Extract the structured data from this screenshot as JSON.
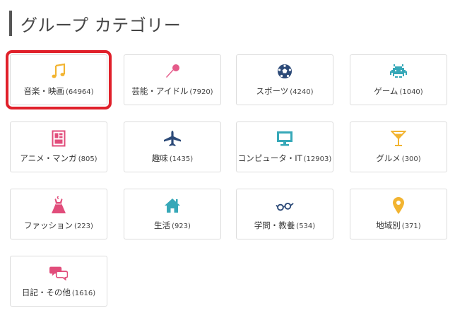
{
  "page": {
    "title": "グループ カテゴリー"
  },
  "categories": [
    {
      "label": "音楽・映画",
      "count": "(64964)",
      "icon": "music-note-icon",
      "color": "#f2b431",
      "selected": true
    },
    {
      "label": "芸能・アイドル",
      "count": "(7920)",
      "icon": "microphone-icon",
      "color": "#e55b8a"
    },
    {
      "label": "スポーツ",
      "count": "(4240)",
      "icon": "soccer-ball-icon",
      "color": "#2c4a78"
    },
    {
      "label": "ゲーム",
      "count": "(1040)",
      "icon": "space-invader-icon",
      "color": "#36a8b8"
    },
    {
      "label": "アニメ・マンガ",
      "count": "(805)",
      "icon": "manga-book-icon",
      "color": "#e14d7b"
    },
    {
      "label": "趣味",
      "count": "(1435)",
      "icon": "airplane-icon",
      "color": "#2c4a78"
    },
    {
      "label": "コンピュータ・IT",
      "count": "(12903)",
      "icon": "monitor-icon",
      "color": "#36a8b8"
    },
    {
      "label": "グルメ",
      "count": "(300)",
      "icon": "cocktail-glass-icon",
      "color": "#f2b431"
    },
    {
      "label": "ファッション",
      "count": "(223)",
      "icon": "dress-icon",
      "color": "#e14d7b"
    },
    {
      "label": "生活",
      "count": "(923)",
      "icon": "house-icon",
      "color": "#36a8b8"
    },
    {
      "label": "学問・教養",
      "count": "(534)",
      "icon": "glasses-icon",
      "color": "#2c4a78"
    },
    {
      "label": "地域別",
      "count": "(371)",
      "icon": "map-pin-icon",
      "color": "#f2b431"
    },
    {
      "label": "日記・その他",
      "count": "(1616)",
      "icon": "speech-bubbles-icon",
      "color": "#e14d7b"
    }
  ]
}
